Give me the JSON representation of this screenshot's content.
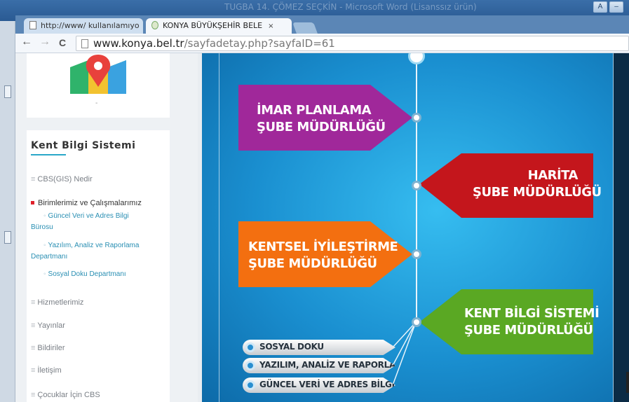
{
  "window": {
    "ghost_title": "TUGBA 14. ÇÖMEZ SEÇKİN - Microsoft Word (Lisanssız ürün)",
    "minimize": "–"
  },
  "tabs": [
    {
      "label": "http://www/ kullanılamıyo",
      "close": "×"
    },
    {
      "label": "KONYA BÜYÜKŞEHİR BELE",
      "close": "×"
    }
  ],
  "toolbar": {
    "back": "←",
    "forward": "→",
    "reload": "C",
    "url_host": "www.konya.bel.tr",
    "url_path": "/sayfadetay.php?sayfaID=61"
  },
  "sidebar": {
    "logo_caption": "-",
    "title": "Kent Bilgi Sistemi",
    "items": [
      {
        "label": "CBS(GIS) Nedir"
      },
      {
        "label": "Birimlerimiz ve Çalışmalarımız"
      },
      {
        "label": "Hizmetlerimiz"
      },
      {
        "label": "Yayınlar"
      },
      {
        "label": "Bildiriler"
      },
      {
        "label": "İletişim"
      },
      {
        "label": "Çocuklar İçin CBS"
      }
    ],
    "subitems": [
      {
        "line1": "Güncel Veri ve Adres Bilgi",
        "line2": "Bürosu"
      },
      {
        "line1": "Yazılım, Analiz ve Raporlama",
        "line2": "Departmanı"
      },
      {
        "line1": "Sosyal Doku Departmanı"
      }
    ],
    "bullet": "≡",
    "sub_bullet": "◦"
  },
  "infographic": {
    "branches": [
      {
        "line1": "İMAR PLANLAMA",
        "line2": "ŞUBE MÜDÜRLÜĞÜ",
        "color": "#a0289a"
      },
      {
        "line1": "HARİTA",
        "line2": "ŞUBE MÜDÜRLÜĞÜ",
        "color": "#c4161c"
      },
      {
        "line1": "KENTSEL İYİLEŞTİRME",
        "line2": "ŞUBE MÜDÜRLÜĞÜ",
        "color": "#f36f10"
      },
      {
        "line1": "KENT BİLGİ SİSTEMİ",
        "line2": "ŞUBE MÜDÜRLÜĞÜ",
        "color": "#5aa823"
      }
    ],
    "departments": [
      "SOSYAL DOKU",
      "YAZILIM, ANALİZ VE RAPORLAMA",
      "GÜNCEL VERİ VE ADRES BİLGİ"
    ]
  }
}
